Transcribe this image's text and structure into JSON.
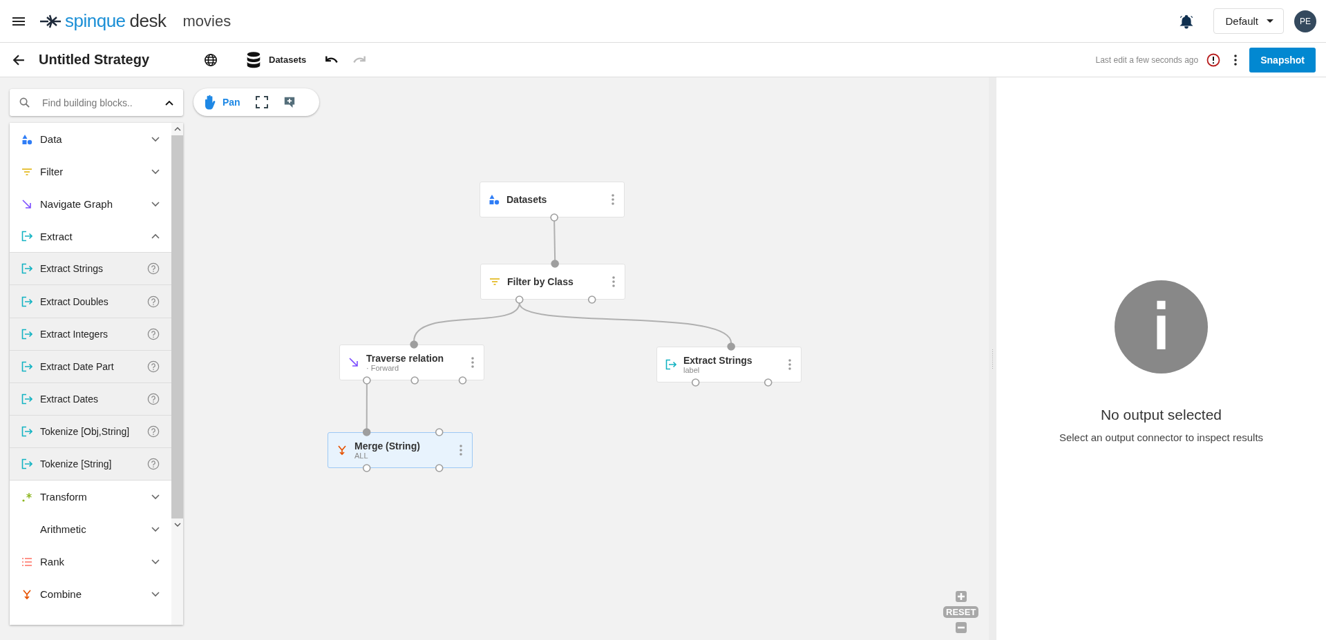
{
  "header": {
    "brand": "spinque",
    "product": "desk",
    "project": "movies",
    "profile": "Default",
    "avatar": "PE"
  },
  "toolbar": {
    "title": "Untitled Strategy",
    "datasets": "Datasets",
    "redo_disabled": true,
    "last_edit": "Last edit a few seconds ago",
    "snapshot": "Snapshot"
  },
  "search": {
    "placeholder": "Find building blocks..",
    "expanded": true
  },
  "canvas_tools": {
    "pan": {
      "label": "Pan",
      "selected": true
    }
  },
  "palette": [
    {
      "label": "Data",
      "kind": "data",
      "expanded": false
    },
    {
      "label": "Filter",
      "kind": "filter",
      "expanded": false
    },
    {
      "label": "Navigate Graph",
      "kind": "navigate",
      "expanded": false
    },
    {
      "label": "Extract",
      "kind": "extract",
      "expanded": true,
      "children": [
        {
          "label": "Extract Strings",
          "kind": "extract"
        },
        {
          "label": "Extract Doubles",
          "kind": "extract"
        },
        {
          "label": "Extract Integers",
          "kind": "extract"
        },
        {
          "label": "Extract Date Part",
          "kind": "extract"
        },
        {
          "label": "Extract Dates",
          "kind": "extract"
        },
        {
          "label": "Tokenize [Obj,String]",
          "kind": "extract"
        },
        {
          "label": "Tokenize [String]",
          "kind": "extract"
        }
      ]
    },
    {
      "label": "Transform",
      "kind": "transform",
      "expanded": false
    },
    {
      "label": "Arithmetic",
      "kind": "plain",
      "expanded": false
    },
    {
      "label": "Rank",
      "kind": "rank",
      "expanded": false
    },
    {
      "label": "Combine",
      "kind": "combine",
      "expanded": false
    }
  ],
  "nodes": [
    {
      "title": "Datasets",
      "kind": "data",
      "selected": false
    },
    {
      "title": "Filter by Class",
      "kind": "filter",
      "selected": false,
      "inputs": [
        {
          "connected": true
        }
      ]
    },
    {
      "title": "Traverse relation",
      "subtitle": "· Forward",
      "kind": "navigate",
      "selected": false,
      "inputs": [
        {
          "connected": true
        }
      ]
    },
    {
      "title": "Extract Strings",
      "subtitle": "label",
      "kind": "extract",
      "selected": false,
      "inputs": [
        {
          "connected": true
        }
      ]
    },
    {
      "title": "Merge (String)",
      "subtitle": "ALL",
      "kind": "combine",
      "selected": true,
      "inputs": [
        {
          "connected": true
        },
        {
          "connected": false
        }
      ]
    }
  ],
  "zoom_controls": {
    "reset": "RESET"
  },
  "output_panel": {
    "title": "No output selected",
    "message": "Select an output connector to inspect results"
  }
}
